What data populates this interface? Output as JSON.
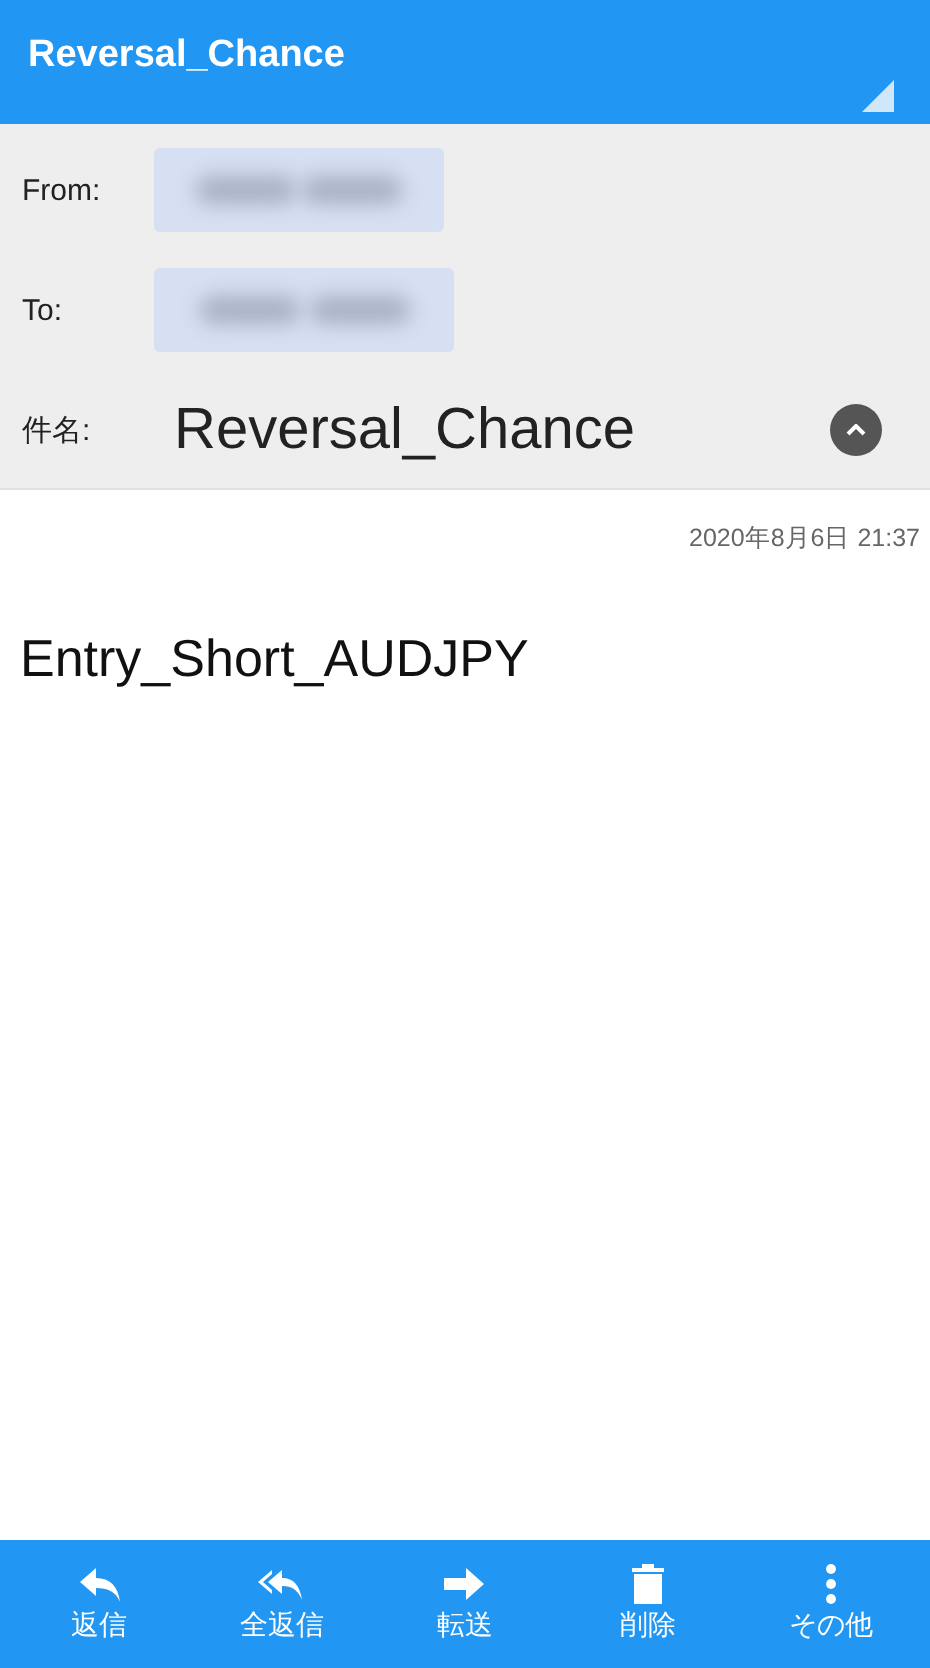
{
  "header": {
    "title": "Reversal_Chance"
  },
  "fields": {
    "from_label": "From:",
    "to_label": "To:",
    "subject_label": "件名:",
    "subject": "Reversal_Chance",
    "expanded": true
  },
  "date": "2020年8月6日 21:37",
  "body": "Entry_Short_AUDJPY",
  "toolbar": [
    {
      "kind": "reply",
      "label": "返信"
    },
    {
      "kind": "reply_all",
      "label": "全返信"
    },
    {
      "kind": "forward",
      "label": "転送"
    },
    {
      "kind": "delete",
      "label": "削除"
    },
    {
      "kind": "more",
      "label": "その他"
    }
  ]
}
